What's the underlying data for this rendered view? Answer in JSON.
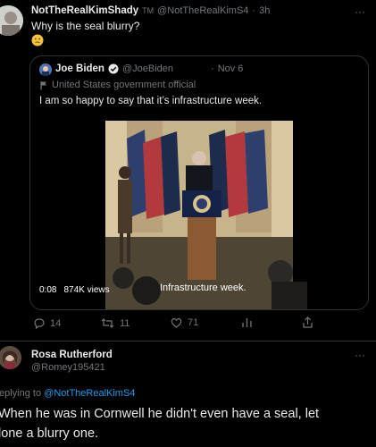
{
  "tweet": {
    "author_name": "NotTheRealKimShady",
    "author_badge": "TM",
    "handle": "@NotTheRealKimS4",
    "separator": "·",
    "time": "3h",
    "text": "Why is the seal blurry?",
    "emoji": "🤔",
    "more": "···"
  },
  "quote": {
    "author_name": "Joe Biden",
    "handle": "@JoeBiden",
    "separator": "·",
    "date": "Nov 6",
    "label": "United States government official",
    "text": "I am so happy to say that it’s infrastructure week.",
    "video": {
      "time": "0:08",
      "views": "874K views",
      "caption": "Infrastructure week."
    }
  },
  "actions": {
    "replies": "14",
    "retweets": "11",
    "likes": "71"
  },
  "reply": {
    "author_name": "Rosa Rutherford",
    "handle": "@Romey195421",
    "more": "···",
    "replying_prefix": "eplying to",
    "replying_to": "@NotTheRealKimS4",
    "text_line1": "When he was in Cornwell he didn't even have a seal, let",
    "text_line2": "lone a blurry one."
  },
  "colors": {
    "background": "#000000",
    "text": "#e7e9ea",
    "muted": "#71767b",
    "link": "#1d9bf0",
    "border": "#2f3336"
  },
  "icons": [
    "ellipsis-icon",
    "verified-icon",
    "flag-icon",
    "reply-icon",
    "retweet-icon",
    "like-icon",
    "analytics-icon",
    "share-icon"
  ]
}
